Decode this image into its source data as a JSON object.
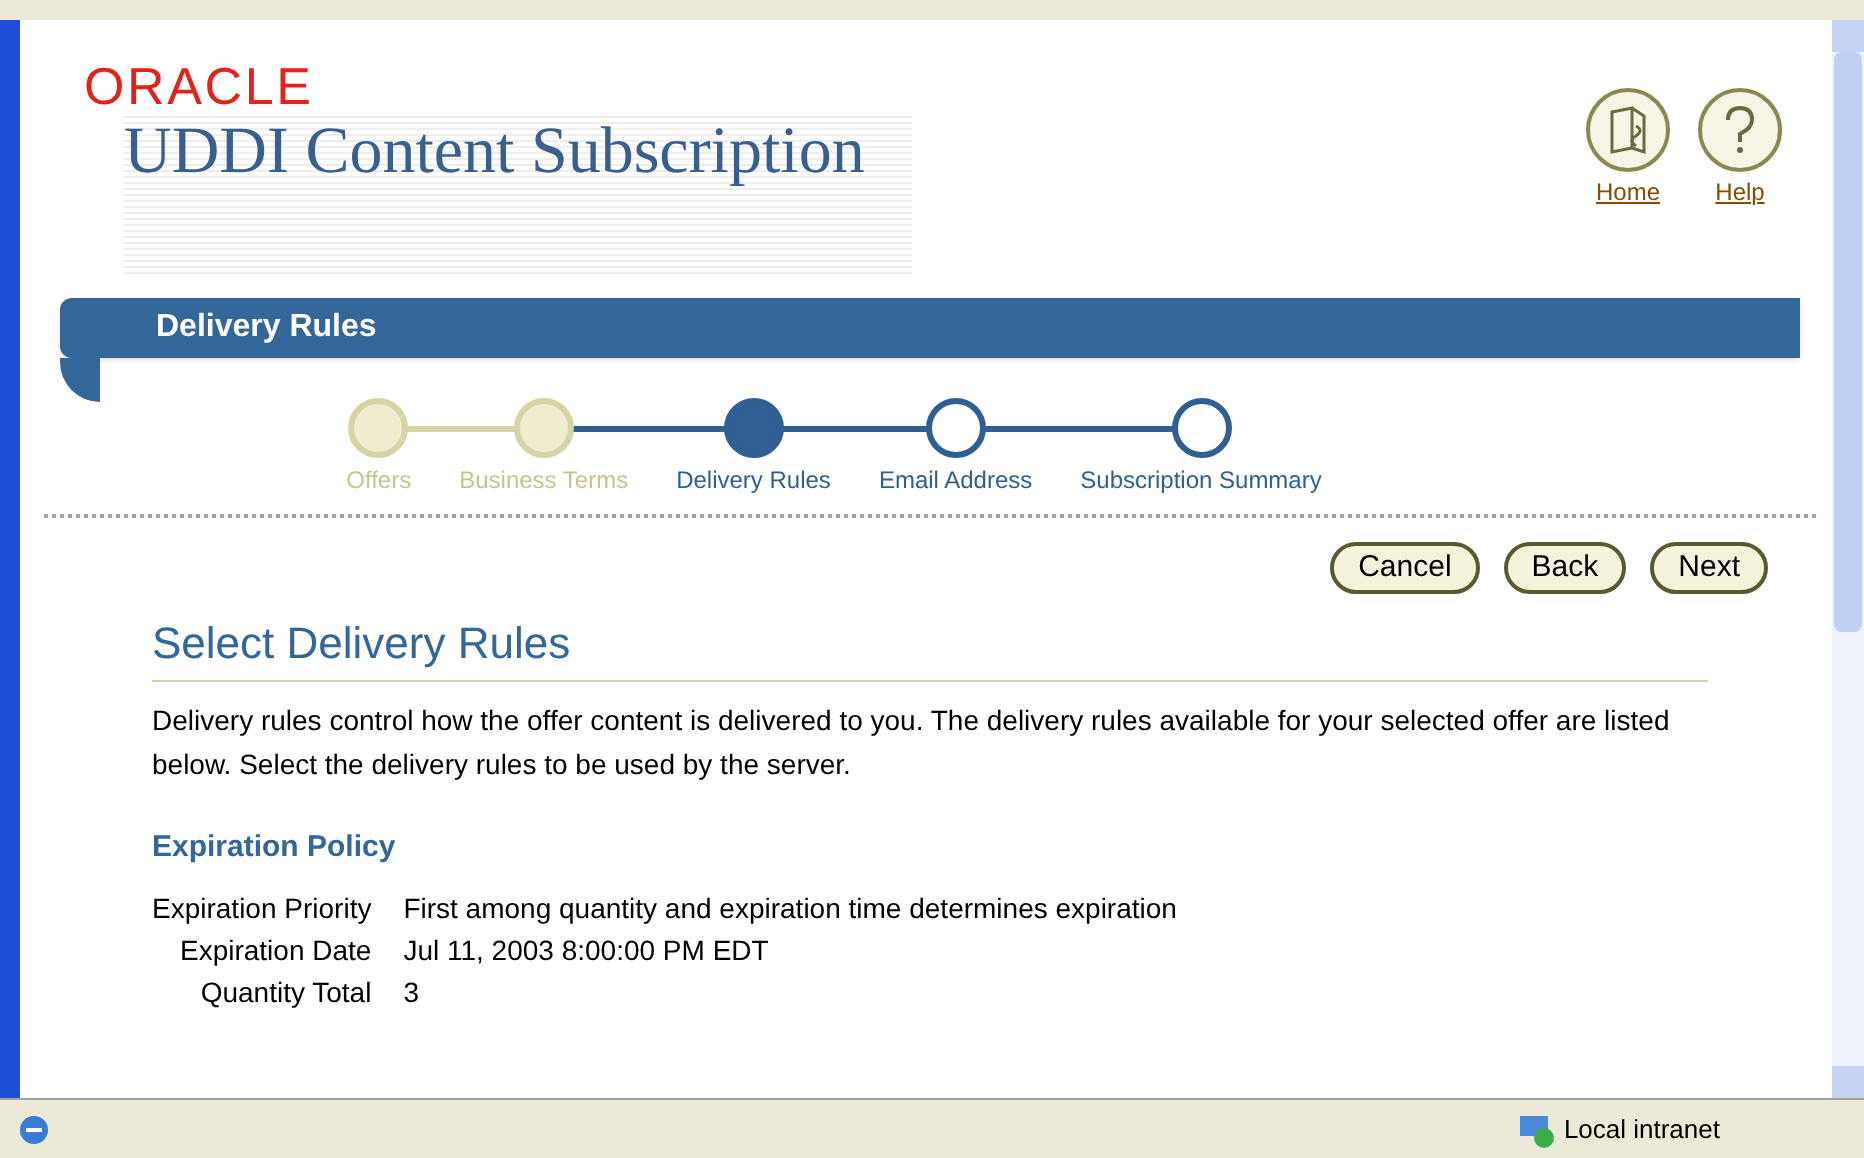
{
  "header": {
    "brand": "ORACLE",
    "title": "UDDI Content Subscription",
    "links": [
      {
        "kind": "home",
        "label": "Home"
      },
      {
        "kind": "help",
        "label": "Help"
      }
    ]
  },
  "banner": {
    "title": "Delivery Rules"
  },
  "steps": [
    {
      "label": "Offers",
      "visited": true,
      "selected": false
    },
    {
      "label": "Business Terms",
      "visited": true,
      "selected": false
    },
    {
      "label": "Delivery Rules",
      "visited": false,
      "selected": true
    },
    {
      "label": "Email Address",
      "visited": false,
      "selected": false
    },
    {
      "label": "Subscription Summary",
      "visited": false,
      "selected": false
    }
  ],
  "buttons": [
    "Cancel",
    "Back",
    "Next"
  ],
  "section": {
    "title": "Select Delivery Rules",
    "description": "Delivery rules control how the offer content is delivered to you. The delivery rules available for your selected offer are listed below. Select the delivery rules to be used by the server."
  },
  "policy": {
    "title": "Expiration Policy",
    "fields": [
      {
        "label": "Expiration Priority",
        "value": "First among quantity and expiration time determines expiration"
      },
      {
        "label": "Expiration Date",
        "value": "Jul 11, 2003 8:00:00 PM EDT"
      },
      {
        "label": "Quantity Total",
        "value": "3"
      }
    ]
  },
  "status_bar": {
    "zone": "Local intranet"
  }
}
